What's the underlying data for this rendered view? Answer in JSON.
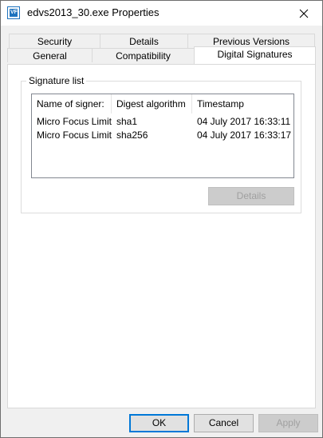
{
  "window": {
    "title": "edvs2013_30.exe Properties",
    "icon": "vf-app-icon",
    "icon_text": "VF"
  },
  "tabs": {
    "row_back": [
      {
        "label": "Security"
      },
      {
        "label": "Details"
      },
      {
        "label": "Previous Versions"
      }
    ],
    "row_front": [
      {
        "label": "General"
      },
      {
        "label": "Compatibility"
      },
      {
        "label": "Digital Signatures",
        "active": true
      }
    ]
  },
  "signature_group": {
    "label": "Signature list",
    "columns": [
      "Name of signer:",
      "Digest algorithm",
      "Timestamp"
    ],
    "rows": [
      {
        "signer": "Micro Focus Limit...",
        "digest": "sha1",
        "timestamp": "04 July 2017 16:33:11"
      },
      {
        "signer": "Micro Focus Limit...",
        "digest": "sha256",
        "timestamp": "04 July 2017 16:33:17"
      }
    ],
    "details_label": "Details"
  },
  "footer": {
    "ok_label": "OK",
    "cancel_label": "Cancel",
    "apply_label": "Apply"
  },
  "colors": {
    "accent": "#0078d7",
    "icon_blue": "#1e73be",
    "dialog_bg": "#f0f0f0",
    "disabled_text": "#a0a0a0"
  }
}
